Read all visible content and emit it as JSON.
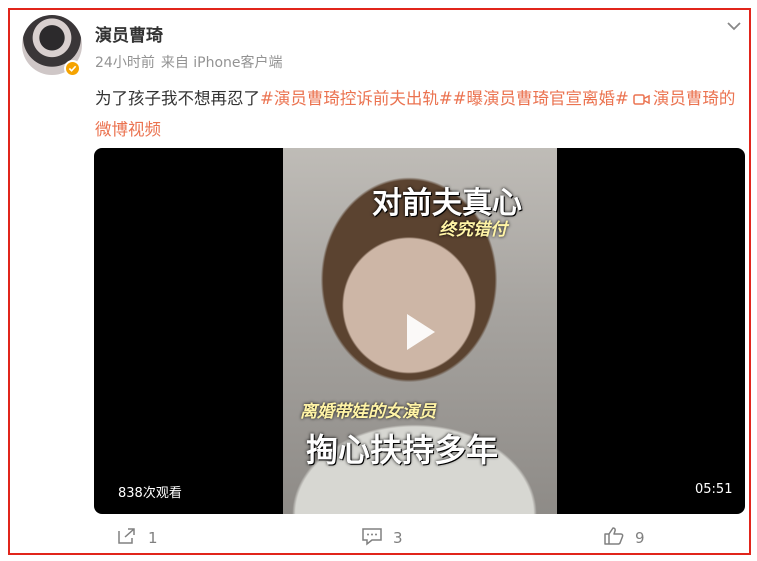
{
  "post": {
    "username": "演员曹琦",
    "time": "24小时前",
    "source": "来自 iPhone客户端",
    "text_plain": "为了孩子我不想再忍了",
    "tag1": "#演员曹琦控诉前夫出轨#",
    "tag2": "#曝演员曹琦官宣离婚#",
    "video_link": "演员曹琦的微博视频",
    "link_color": "#eb7350",
    "verified_badge_color": "#f5a300"
  },
  "video": {
    "caption_title": "对前夫真心",
    "caption_sub": "终究错付",
    "caption_bottom_small": "离婚带娃的女演员",
    "caption_bottom_big": "掏心扶持多年",
    "views": "838次观看",
    "duration": "05:51"
  },
  "actions": {
    "repost_count": "1",
    "comment_count": "3",
    "like_count": "9"
  },
  "icons": [
    "chevron-down-icon",
    "verified-badge-icon",
    "video-camera-icon",
    "play-icon",
    "repost-icon",
    "comment-icon",
    "like-icon"
  ],
  "frame_color": "#e1251b"
}
